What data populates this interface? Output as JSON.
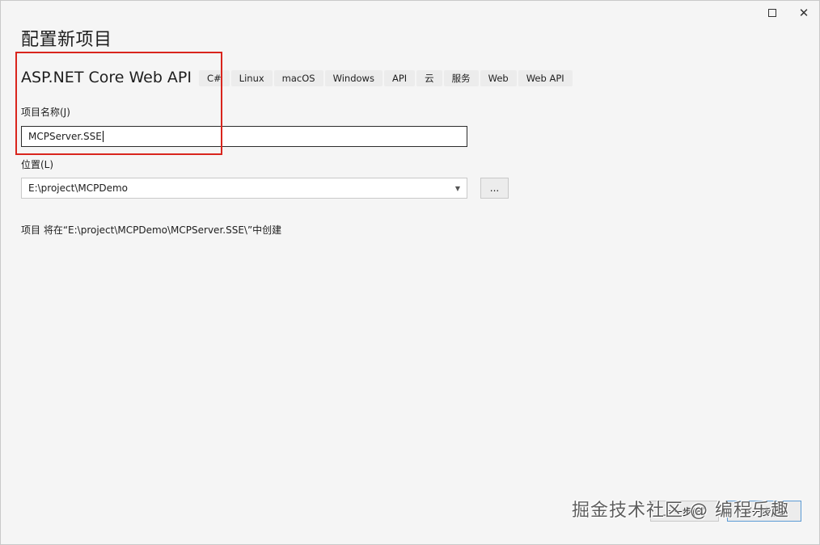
{
  "window": {
    "maximize_icon": "maximize-icon",
    "close_glyph": "✕"
  },
  "page": {
    "title": "配置新项目",
    "template_name": "ASP.NET Core Web API",
    "tags": [
      "C#",
      "Linux",
      "macOS",
      "Windows",
      "API",
      "云",
      "服务",
      "Web",
      "Web API"
    ]
  },
  "form": {
    "project_name_label": "项目名称(J)",
    "project_name_value": "MCPServer.SSE",
    "location_label": "位置(L)",
    "location_value": "E:\\project\\MCPDemo",
    "browse_label": "...",
    "info_text": "项目 将在“E:\\project\\MCPDemo\\MCPServer.SSE\\”中创建"
  },
  "footer": {
    "back_label": "上一步(B)",
    "next_label": "下一步(N)"
  },
  "watermark": "掘金技术社区 @ 编程乐趣",
  "colors": {
    "highlight": "#d9251d",
    "background": "#f5f5f5"
  }
}
